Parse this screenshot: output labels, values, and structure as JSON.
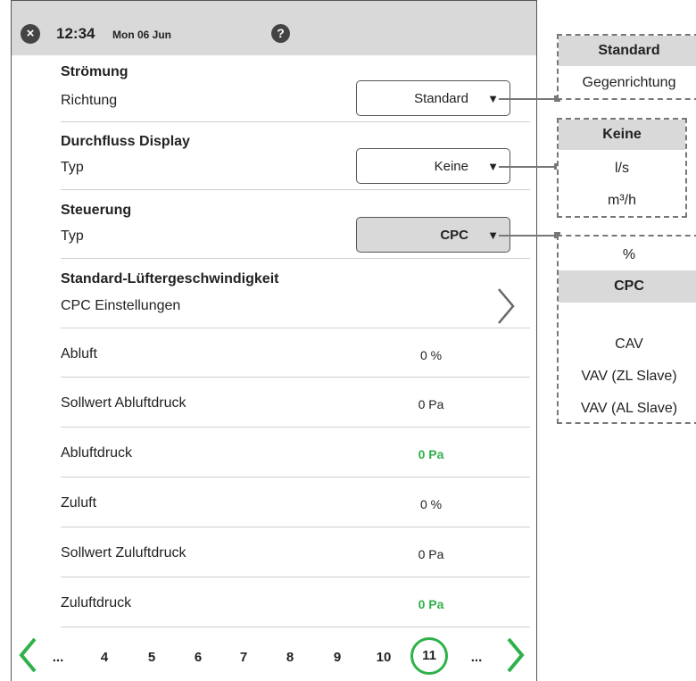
{
  "header": {
    "time": "12:34",
    "date": "Mon 06 Jun",
    "close_icon": "×",
    "help_icon": "?"
  },
  "sections": {
    "stroemung": {
      "title": "Strömung",
      "label": "Richtung",
      "dropdown_value": "Standard"
    },
    "durchfluss": {
      "title": "Durchfluss Display",
      "label": "Typ",
      "dropdown_value": "Keine"
    },
    "steuerung": {
      "title": "Steuerung",
      "label": "Typ",
      "dropdown_value": "CPC"
    },
    "standard_fan": {
      "title": "Standard-Lüftergeschwindigkeit",
      "label": "CPC Einstellungen"
    }
  },
  "dropdown_arrow": "▼",
  "rows": [
    {
      "label": "Abluft",
      "value": "0 %"
    },
    {
      "label": "Sollwert Abluftdruck",
      "value": "0 Pa"
    },
    {
      "label": "Abluftdruck",
      "value": "0 Pa"
    },
    {
      "label": "Zuluft",
      "value": "0 %"
    },
    {
      "label": "Sollwert Zuluftdruck",
      "value": "0 Pa"
    },
    {
      "label": "Zuluftdruck",
      "value": "0 Pa"
    }
  ],
  "pager": {
    "pages": [
      "...",
      "4",
      "5",
      "6",
      "7",
      "8",
      "9",
      "10",
      "11",
      "..."
    ],
    "current": "11"
  },
  "popups": {
    "richtung_options": [
      "Standard",
      "Gegenrichtung"
    ],
    "richtung_selected": "Standard",
    "durchfluss_options": [
      "Keine",
      "l/s",
      "m³/h"
    ],
    "durchfluss_selected": "Keine",
    "steuerung_options": [
      "%",
      "CPC",
      "CAV",
      "VAV (ZL Slave)",
      "VAV (AL Slave)"
    ],
    "steuerung_selected": "CPC"
  },
  "colors": {
    "accent_green": "#2fb14a",
    "header_gray": "#d9d9d9"
  },
  "icons": {
    "close": "close-icon",
    "help": "help-icon",
    "next_page": "chevron-right-icon",
    "prev_page": "chevron-left-icon"
  }
}
